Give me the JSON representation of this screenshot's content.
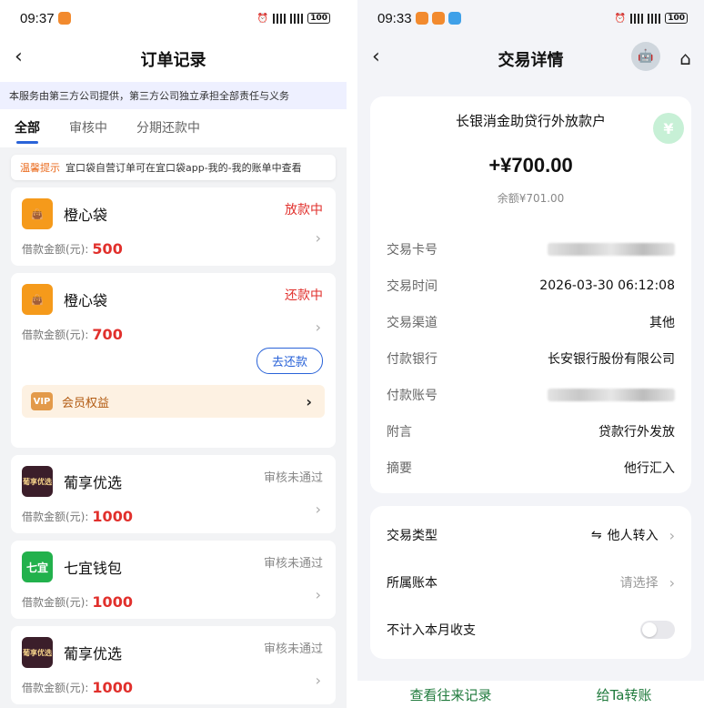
{
  "left": {
    "status": {
      "time": "09:37",
      "battery": "100"
    },
    "nav": {
      "title": "订单记录"
    },
    "notice": "本服务由第三方公司提供，第三方公司独立承担全部责任与义务",
    "tabs": [
      "全部",
      "审核中",
      "分期还款中"
    ],
    "tip": {
      "tag": "温馨提示",
      "text": "宜口袋自营订单可在宜口袋app-我的-我的账单中查看"
    },
    "amount_label": "借款金额(元):",
    "orders": [
      {
        "name": "橙心袋",
        "status": "放款中",
        "amount": "500"
      },
      {
        "name": "橙心袋",
        "status": "还款中",
        "amount": "700",
        "button": "去还款",
        "vip": "会员权益",
        "vip_badge": "VIP"
      },
      {
        "name": "葡享优选",
        "status": "审核未通过",
        "amount": "1000",
        "logo_text": "葡享优选"
      },
      {
        "name": "七宜钱包",
        "status": "审核未通过",
        "amount": "1000",
        "logo_text": "七宜"
      },
      {
        "name": "葡享优选",
        "status": "审核未通过",
        "amount": "1000",
        "logo_text": "葡享优选"
      }
    ]
  },
  "right": {
    "status": {
      "time": "09:33",
      "battery": "100"
    },
    "nav": {
      "title": "交易详情"
    },
    "account": "长银消金助贷行外放款户",
    "amount": "+¥700.00",
    "balance": "余额¥701.00",
    "details": [
      {
        "k": "交易卡号",
        "v": ""
      },
      {
        "k": "交易时间",
        "v": "2026-03-30 06:12:08"
      },
      {
        "k": "交易渠道",
        "v": "其他"
      },
      {
        "k": "付款银行",
        "v": "长安银行股份有限公司"
      },
      {
        "k": "付款账号",
        "v": ""
      },
      {
        "k": "附言",
        "v": "贷款行外发放"
      },
      {
        "k": "摘要",
        "v": "他行汇入"
      }
    ],
    "type_label": "交易类型",
    "type_value": "他人转入",
    "ledger_label": "所属账本",
    "ledger_value": "请选择",
    "exclude_label": "不计入本月收支",
    "footer_left": "查看往来记录",
    "footer_right": "给Ta转账"
  }
}
